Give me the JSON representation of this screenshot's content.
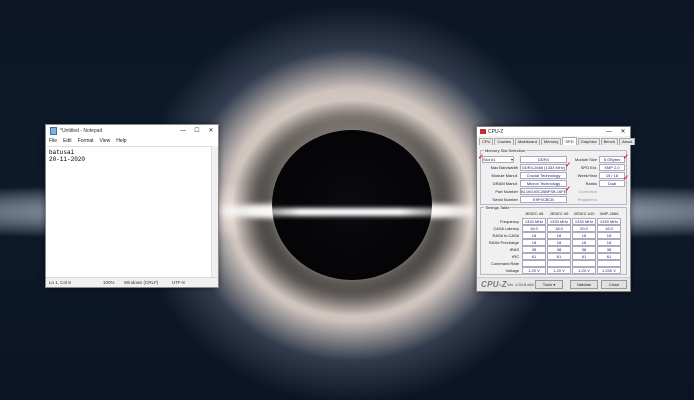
{
  "notepad": {
    "title": "*Untitled - Notepad",
    "menu": [
      "File",
      "Edit",
      "Format",
      "View",
      "Help"
    ],
    "content_lines": [
      "batusai",
      "20-11-2020"
    ],
    "status": {
      "position": "Ln 1, Col 8",
      "zoom": "100%",
      "line_ending": "Windows (CRLF)",
      "encoding": "UTF-8"
    },
    "controls": {
      "minimize": "—",
      "maximize": "☐",
      "close": "✕"
    }
  },
  "cpuz": {
    "title": "CPU-Z",
    "tabs": [
      "CPU",
      "Caches",
      "Mainboard",
      "Memory",
      "SPD",
      "Graphics",
      "Bench",
      "About"
    ],
    "active_tab": "SPD",
    "slot_group_label": "Memory Slot Selection",
    "slot": "Slot #1",
    "memory_type": "DDR4",
    "labels": {
      "max_bandwidth": "Max Bandwidth",
      "module_manuf": "Module Manuf.",
      "dram_manuf": "DRAM Manuf.",
      "part_number": "Part Number",
      "serial_number": "Serial Number",
      "module_size": "Module Size",
      "spd_ext": "SPD Ext.",
      "week_year": "Week/Year",
      "ranks": "Ranks",
      "correction": "Correction",
      "registered": "Registered"
    },
    "values": {
      "max_bandwidth": "DDR4-2666 (1333 MHz)",
      "module_manuf": "Crucial Technology",
      "dram_manuf": "Micron Technology",
      "part_number": "BL16G40C26BFSB.16FE",
      "serial_number": "E9F9CBCB",
      "module_size": "8 GBytes",
      "spd_ext": "XMP 2.0",
      "week_year": "19 / 18",
      "ranks": "Dual"
    },
    "timings": {
      "group_label": "Timings Table",
      "columns": [
        "JEDEC #8",
        "JEDEC #9",
        "JEDEC #10",
        "XMP-2666"
      ],
      "rows": [
        {
          "label": "Frequency",
          "values": [
            "1333 MHz",
            "1333 MHz",
            "1333 MHz",
            "1333 MHz"
          ]
        },
        {
          "label": "CAS# Latency",
          "values": [
            "16.0",
            "18.0",
            "20.0",
            "16.0"
          ]
        },
        {
          "label": "RAS# to CAS#",
          "values": [
            "18",
            "18",
            "18",
            "18"
          ]
        },
        {
          "label": "RAS# Precharge",
          "values": [
            "18",
            "18",
            "18",
            "18"
          ]
        },
        {
          "label": "tRAS",
          "values": [
            "38",
            "38",
            "38",
            "38"
          ]
        },
        {
          "label": "tRC",
          "values": [
            "61",
            "61",
            "61",
            "61"
          ]
        },
        {
          "label": "Command Rate",
          "values": [
            "",
            "",
            "",
            ""
          ]
        },
        {
          "label": "Voltage",
          "values": [
            "1.20 V",
            "1.20 V",
            "1.20 V",
            "1.200 V"
          ]
        }
      ]
    },
    "footer": {
      "logo": "CPU-Z",
      "version": "Ver. 1.94.8.x64",
      "tools": "Tools",
      "validate": "Validate",
      "close": "Close"
    },
    "controls": {
      "minimize": "—",
      "close": "✕"
    },
    "check_mark_color": "#d01818"
  }
}
